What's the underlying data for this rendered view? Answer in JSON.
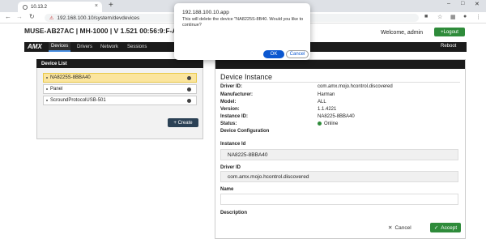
{
  "browser": {
    "tab_title": "10.13.2",
    "tab_close": "×",
    "new_tab": "+",
    "url": "192.168.100.10/system/devdevices",
    "security_label": "Not secure"
  },
  "header": {
    "device_title": "MUSE-AB27AC | MH-1000 | V 1.521 00:56:9:F-AB",
    "welcome": "Welcome, admin",
    "logout": "+Logout"
  },
  "menu": {
    "logo": "AMX",
    "items": [
      "Devices",
      "Drivers",
      "Network",
      "Sessions"
    ],
    "reboot": "Reboot"
  },
  "device_list": {
    "heading": "Device List",
    "items": [
      {
        "label": "NA8225S-8BBA40",
        "selected": true
      },
      {
        "label": "Panel",
        "selected": false
      },
      {
        "label": "ScroundProtocolUSB-501",
        "selected": false
      }
    ],
    "create": "+ Create"
  },
  "instance": {
    "title": "Device Instance",
    "fields": [
      {
        "key": "Driver ID:",
        "value": "com.amx.mojo.hcontrol.discovered"
      },
      {
        "key": "Manufacturer:",
        "value": "Harman"
      },
      {
        "key": "Model:",
        "value": "ALL"
      },
      {
        "key": "Version:",
        "value": "1.1.4221"
      },
      {
        "key": "Instance ID:",
        "value": "NA8225-8BBA40"
      },
      {
        "key": "Status:",
        "value": "Online"
      }
    ],
    "config_heading": "Device Configuration",
    "instance_id_label": "Instance Id",
    "instance_id_value": "NA8225-8BBA40",
    "driver_id_label": "Driver ID",
    "driver_id_value": "com.amx.mojo.hcontrol.discovered",
    "name_label": "Name",
    "name_value": "",
    "description_label": "Description",
    "cancel": "Cancel",
    "accept": "Accept"
  },
  "dialog": {
    "title": "192.188.100.10.app",
    "message": "This will delete the device \"NA8225S-8B40. Would you like to continue?",
    "ok": "OK",
    "cancel": "Cancel"
  },
  "colors": {
    "accent_green": "#2e8b3a",
    "dark": "#1b1b1b",
    "selected": "#fbe59e",
    "dialog_blue": "#0b57d0"
  }
}
